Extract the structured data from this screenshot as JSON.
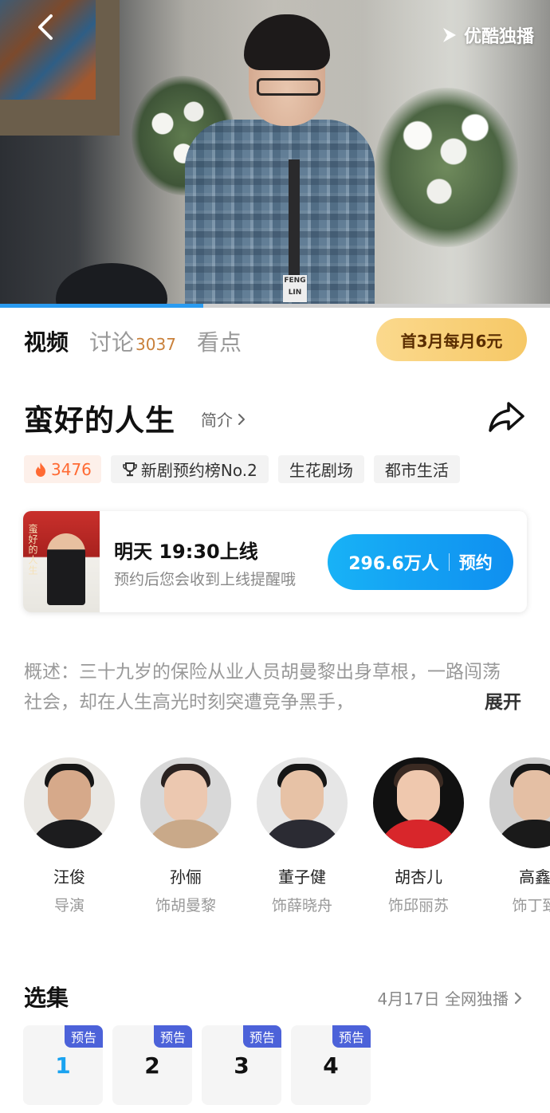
{
  "brand": {
    "label": "优酷独播"
  },
  "player": {
    "progress": 0.37
  },
  "tabs": [
    {
      "label": "视频",
      "active": true
    },
    {
      "label": "讨论",
      "count": "3037"
    },
    {
      "label": "看点"
    }
  ],
  "vip_promo": "首3月每月6元",
  "show": {
    "title": "蛮好的人生",
    "intro_link": "简介"
  },
  "chips": {
    "heat": "3476",
    "ranking": "新剧预约榜No.2",
    "tag1": "生花剧场",
    "tag2": "都市生活"
  },
  "release": {
    "poster_text": "蛮好的人生",
    "time": "明天 19:30上线",
    "note": "预约后您会收到上线提醒哦",
    "reserve_count": "296.6万人",
    "reserve_label": "预约"
  },
  "synopsis": {
    "text": "概述：三十九岁的保险从业人员胡曼黎出身草根，一路闯荡社会，却在人生高光时刻突遭竞争黑手，",
    "expand": "展开"
  },
  "cast": [
    {
      "name": "汪俊",
      "role": "导演"
    },
    {
      "name": "孙俪",
      "role": "饰胡曼黎"
    },
    {
      "name": "董子健",
      "role": "饰薛晓舟"
    },
    {
      "name": "胡杏儿",
      "role": "饰邱丽苏"
    },
    {
      "name": "高鑫",
      "role": "饰丁致"
    }
  ],
  "episodes": {
    "title": "选集",
    "meta": "4月17日 全网独播",
    "items": [
      {
        "number": "1",
        "badge": "预告",
        "current": true
      },
      {
        "number": "2",
        "badge": "预告"
      },
      {
        "number": "3",
        "badge": "预告"
      },
      {
        "number": "4",
        "badge": "预告"
      }
    ]
  },
  "colors": {
    "accent_blue": "#1aa3f0",
    "vip_gold": "#f6c866",
    "hot_orange": "#ff6a33",
    "badge_indigo": "#4c62d9"
  }
}
